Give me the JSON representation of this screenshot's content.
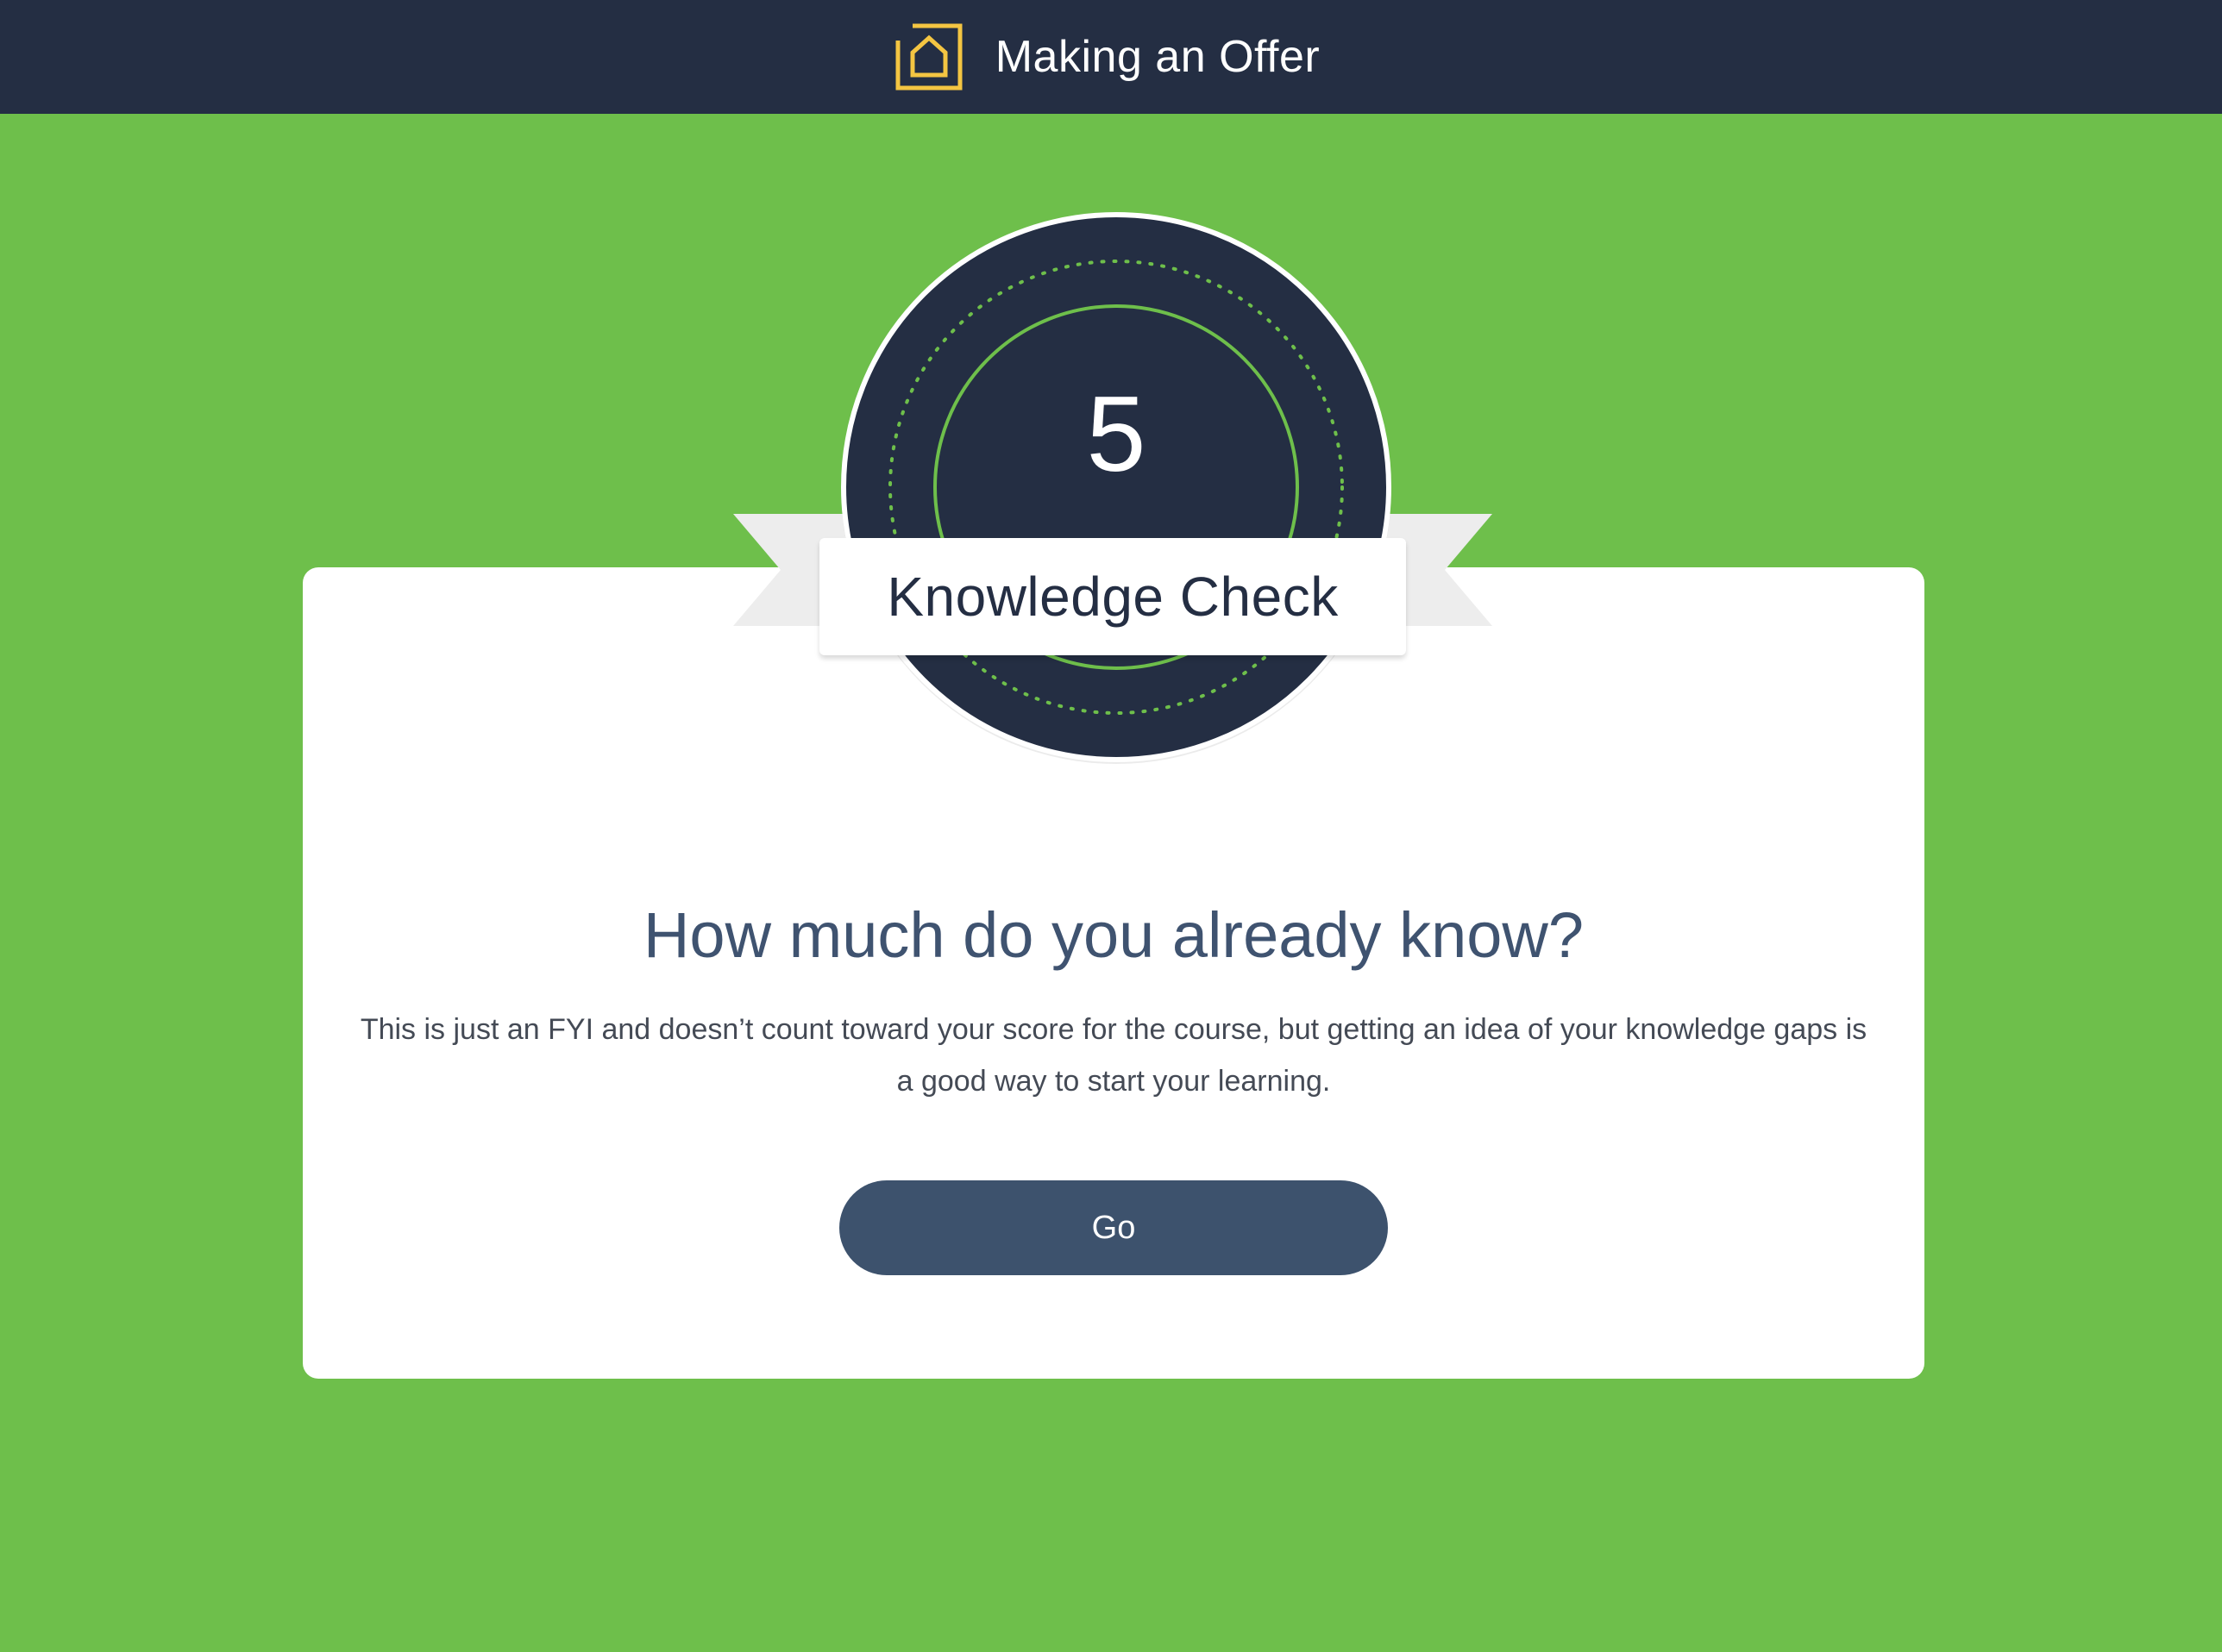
{
  "header": {
    "title": "Making an Offer",
    "logo_icon": "house-outline-icon",
    "background_color": "#242e43",
    "logo_color": "#f4c542"
  },
  "badge": {
    "number": "5",
    "label": "Knowledge Check",
    "medal_color": "#242e43",
    "ring_color": "#6ebf4b"
  },
  "main": {
    "heading": "How much do you already know?",
    "description": "This is just an FYI and doesn’t count toward your score for the course, but getting an idea of your knowledge gaps is a good way to start your learning.",
    "go_button_label": "Go",
    "button_color": "#3d526d"
  },
  "page": {
    "background_color": "#6ebf4b"
  }
}
